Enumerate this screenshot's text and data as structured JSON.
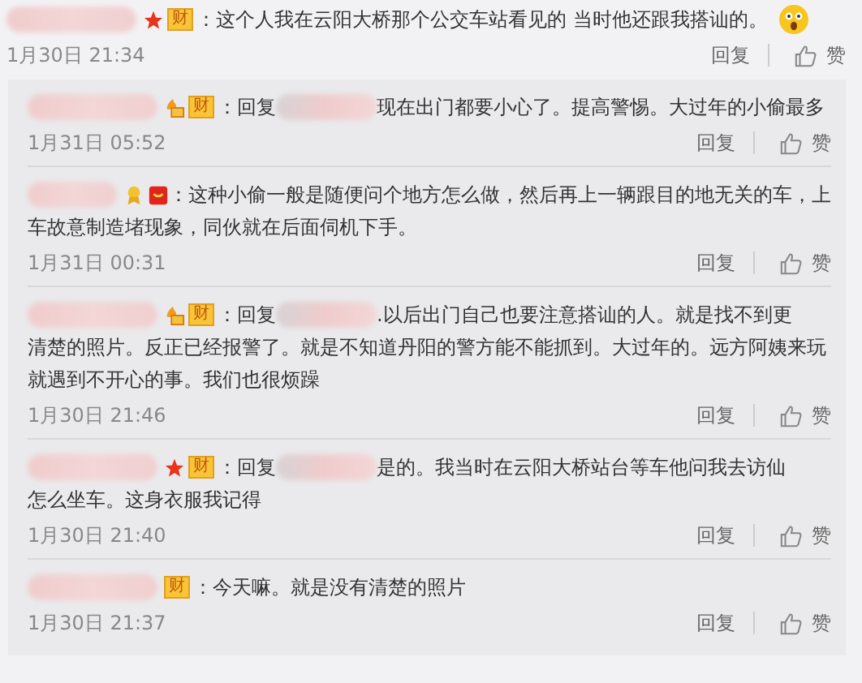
{
  "comment": {
    "icons": [
      {
        "kind": "star"
      }
    ],
    "badge": "财",
    "lines": [
      "：这个人我在云阳大桥那个公交车站看见的 当时他还跟我搭讪的。"
    ],
    "emoji": {
      "kind": "surprised"
    },
    "time": "1月30日 21:34",
    "reply": "回复",
    "like": "赞"
  },
  "replies": [
    {
      "icons": [
        {
          "kind": "fan"
        }
      ],
      "badge": "财",
      "prefix": "：回复",
      "lines": [
        "现在出门都要小心了。提高警惕。大过年的小偷最多"
      ],
      "time": "1月31日 05:52",
      "reply": "回复",
      "like": "赞"
    },
    {
      "icons": [
        {
          "kind": "medal"
        },
        {
          "kind": "envelope"
        }
      ],
      "lines": [
        "：这种小偷一般是随便问个地方怎么做，然后再上一辆跟目的地无关的车，上",
        "车故意制造堵现象，同伙就在后面伺机下手。"
      ],
      "time": "1月31日 00:31",
      "reply": "回复",
      "like": "赞"
    },
    {
      "icons": [
        {
          "kind": "fan"
        }
      ],
      "badge": "财",
      "prefix": "：回复",
      "lines": [
        ".以后出门自己也要注意搭讪的人。就是找不到更",
        "清楚的照片。反正已经报警了。就是不知道丹阳的警方能不能抓到。大过年的。远方阿姨来玩",
        "就遇到不开心的事。我们也很烦躁"
      ],
      "time": "1月30日 21:46",
      "reply": "回复",
      "like": "赞"
    },
    {
      "icons": [
        {
          "kind": "star"
        }
      ],
      "badge": "财",
      "prefix": "：回复",
      "lines": [
        "是的。我当时在云阳大桥站台等车他问我去访仙",
        "怎么坐车。这身衣服我记得"
      ],
      "time": "1月30日 21:40",
      "reply": "回复",
      "like": "赞"
    },
    {
      "badge": "财",
      "lines": [
        "：今天嘛。就是没有清楚的照片"
      ],
      "time": "1月30日 21:37",
      "reply": "回复",
      "like": "赞"
    }
  ]
}
